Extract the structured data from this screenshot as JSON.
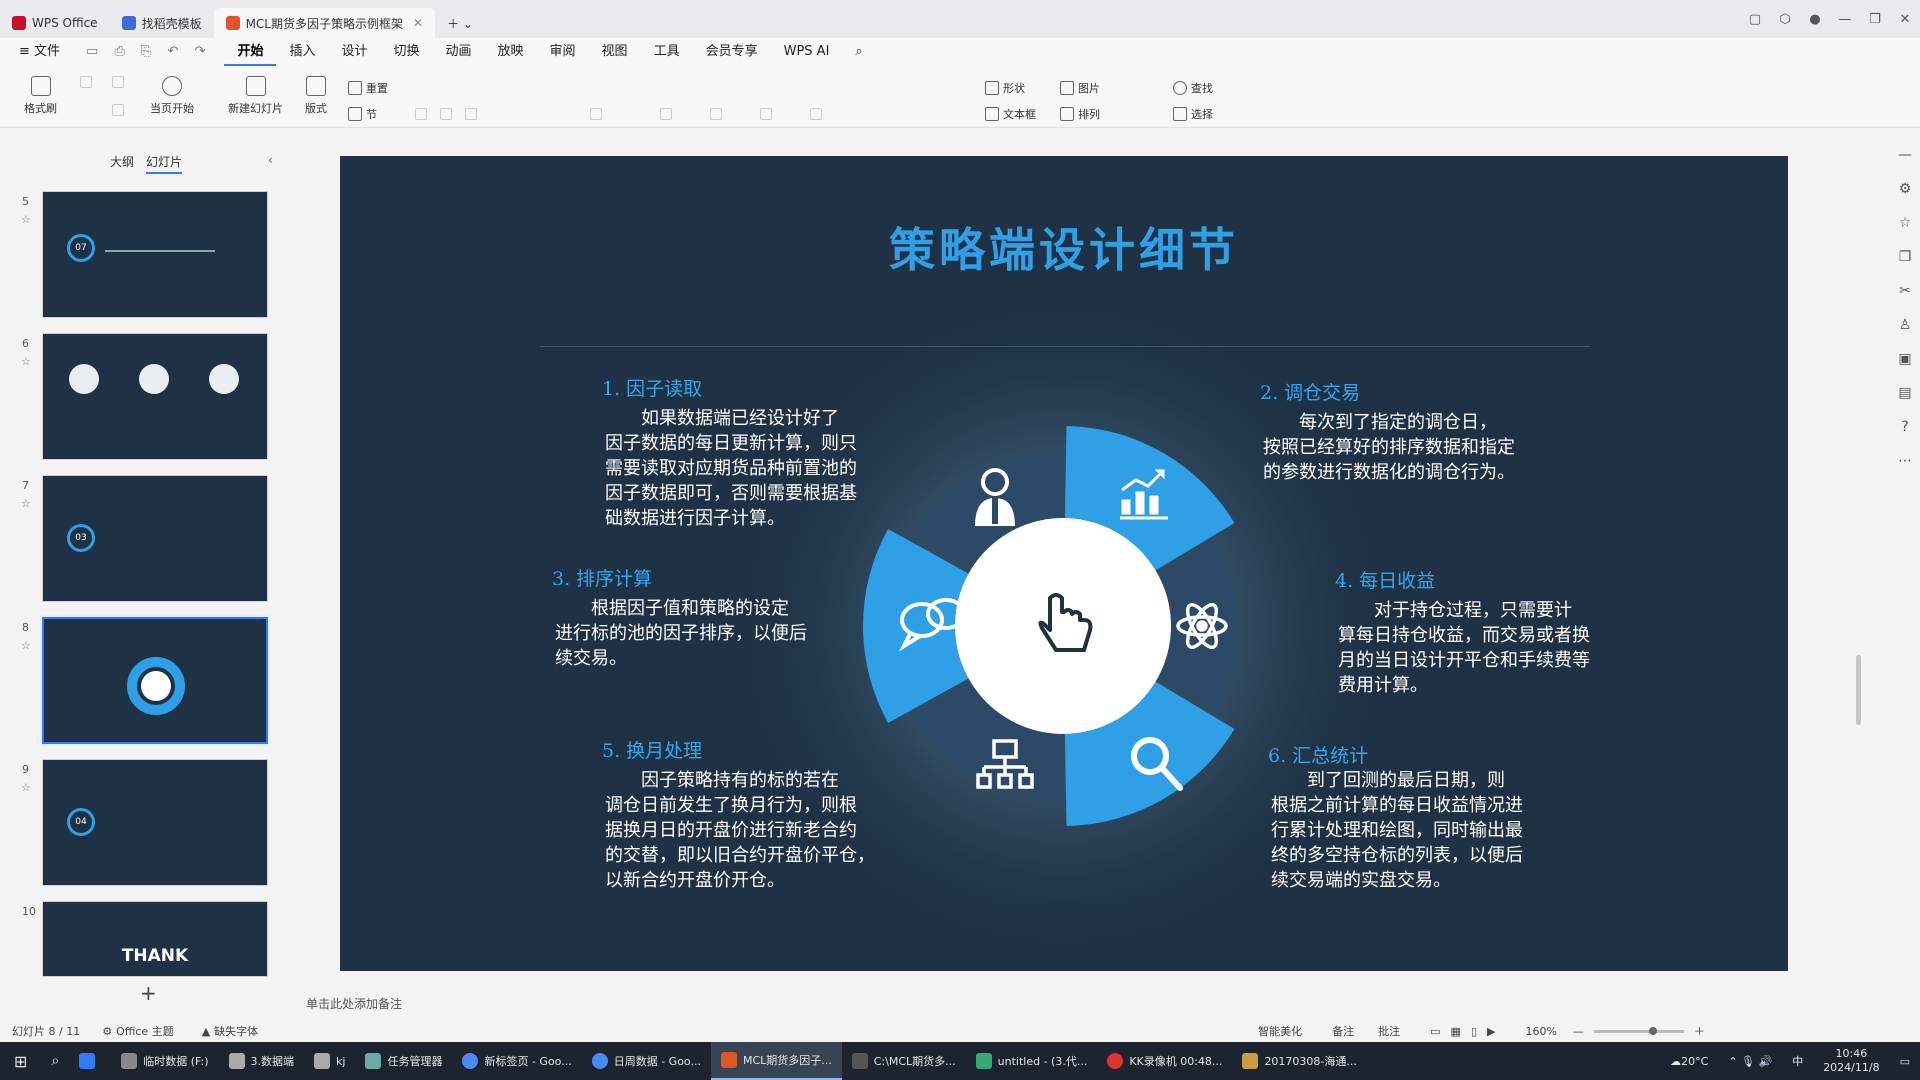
{
  "window": {
    "tabs": [
      {
        "label": "WPS Office"
      },
      {
        "label": "找稻壳模板"
      },
      {
        "label": "MCL期货多因子策略示例框架"
      }
    ]
  },
  "menu": [
    "≡ 文件",
    "开始",
    "插入",
    "设计",
    "切换",
    "动画",
    "放映",
    "审阅",
    "视图",
    "工具",
    "会员专享",
    "WPS AI"
  ],
  "ribbon": {
    "format_brush": "格式刷",
    "play_current": "当页开始",
    "new_slide": "新建幻灯片",
    "layout": "版式",
    "reset": "重置",
    "section": "节",
    "shape": "形状",
    "picture": "图片",
    "find": "查找",
    "textbox": "文本框",
    "arrange": "排列",
    "select": "选择"
  },
  "left_panel": {
    "tab_outline": "大纲",
    "tab_slides": "幻灯片",
    "slide_numbers": [
      "5",
      "6",
      "7",
      "8",
      "9",
      "10"
    ],
    "thumb5_badge": "07",
    "thumb7_badge": "03",
    "thumb9_badge": "04",
    "thumb10_text": "THANK",
    "add": "+"
  },
  "slide": {
    "title": "策略端设计细节",
    "sections": [
      {
        "title": "1. 因子读取",
        "body": [
          "如果数据端已经设计好了",
          "因子数据的每日更新计算，则只",
          "需要读取对应期货品种前置池的",
          "因子数据即可，否则需要根据基",
          "础数据进行因子计算。"
        ]
      },
      {
        "title": "2. 调仓交易",
        "body": [
          "每次到了指定的调仓日，",
          "按照已经算好的排序数据和指定",
          "的参数进行数据化的调仓行为。"
        ]
      },
      {
        "title": "3. 排序计算",
        "body": [
          "根据因子值和策略的设定",
          "进行标的池的因子排序，以便后",
          "续交易。"
        ]
      },
      {
        "title": "4. 每日收益",
        "body": [
          "对于持仓过程，只需要计",
          "算每日持仓收益，而交易或者换",
          "月的当日设计开平仓和手续费等",
          "费用计算。"
        ]
      },
      {
        "title": "5. 换月处理",
        "body": [
          "因子策略持有的标的若在",
          "调仓日前发生了换月行为，则根",
          "据换月日的开盘价进行新老合约",
          "的交替，即以旧合约开盘价平仓，",
          "以新合约开盘价开仓。"
        ]
      },
      {
        "title": "6. 汇总统计",
        "body": [
          "到了回测的最后日期，则",
          "根据之前计算的每日收益情况进",
          "行累计处理和绘图，同时输出最",
          "终的多空持仓标的列表，以便后",
          "续交易端的实盘交易。"
        ]
      }
    ]
  },
  "notes_placeholder": "单击此处添加备注",
  "status": {
    "slide_counter": "幻灯片 8 / 11",
    "theme": "Office 主题",
    "missing_font": "缺失字体",
    "smart_beautify": "智能美化",
    "notes": "备注",
    "comments": "批注",
    "zoom": "160%"
  },
  "taskbar": {
    "items": [
      "临时数据 (F:)",
      "3.数据端",
      "kj",
      "任务管理器",
      "新标签页 - Goo...",
      "日周数据 - Goo...",
      "MCL期货多因子...",
      "C:\\MCL期货多...",
      "untitled - (3.代...",
      "KK录像机 00:48...",
      "20170308-海通..."
    ],
    "temperature": "20°C",
    "ime": "中",
    "time": "10:46",
    "date": "2024/11/8"
  },
  "colors": {
    "slide_bg": "#1f3245",
    "accent_blue": "#2f9fe6",
    "dark_segment": "#2c4a68"
  },
  "icons": [
    "person-icon",
    "chart-icon",
    "chat-icon",
    "atom-icon",
    "hierarchy-icon",
    "search-icon",
    "hand-pointer-icon"
  ]
}
